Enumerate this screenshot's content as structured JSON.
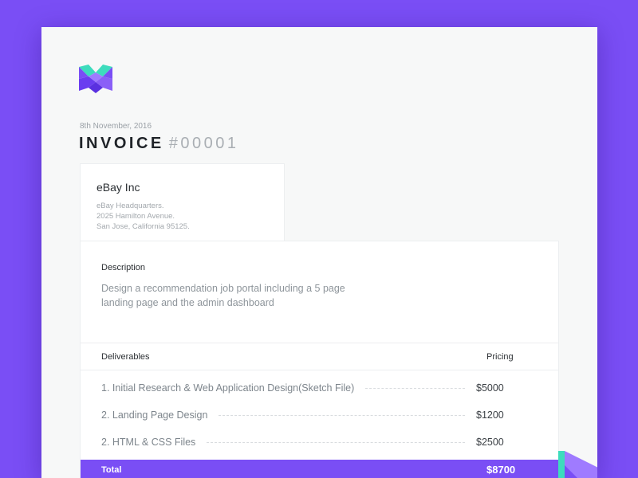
{
  "invoice": {
    "date": "8th November, 2016",
    "title_word": "INVOICE",
    "number": "#00001"
  },
  "client": {
    "name": "eBay Inc",
    "address": [
      "eBay Headquarters.",
      "2025 Hamilton Avenue.",
      "San Jose, California 95125."
    ]
  },
  "description": {
    "label": "Description",
    "text": "Design a recommendation job portal including a 5 page landing page and the admin dashboard"
  },
  "table": {
    "col_deliverables": "Deliverables",
    "col_pricing": "Pricing",
    "rows": [
      {
        "name": "1. Initial Research & Web Application Design(Sketch File)",
        "price": "$5000"
      },
      {
        "name": "2. Landing Page Design",
        "price": "$1200"
      },
      {
        "name": "2. HTML & CSS Files",
        "price": "$2500"
      }
    ],
    "total_label": "Total",
    "total_value": "$8700"
  },
  "colors": {
    "accent": "#7a4ef5",
    "logo_teal": "#3ddcbd",
    "logo_purple": "#7a4ef5"
  },
  "icons": {
    "logo": "x-logo-icon"
  }
}
